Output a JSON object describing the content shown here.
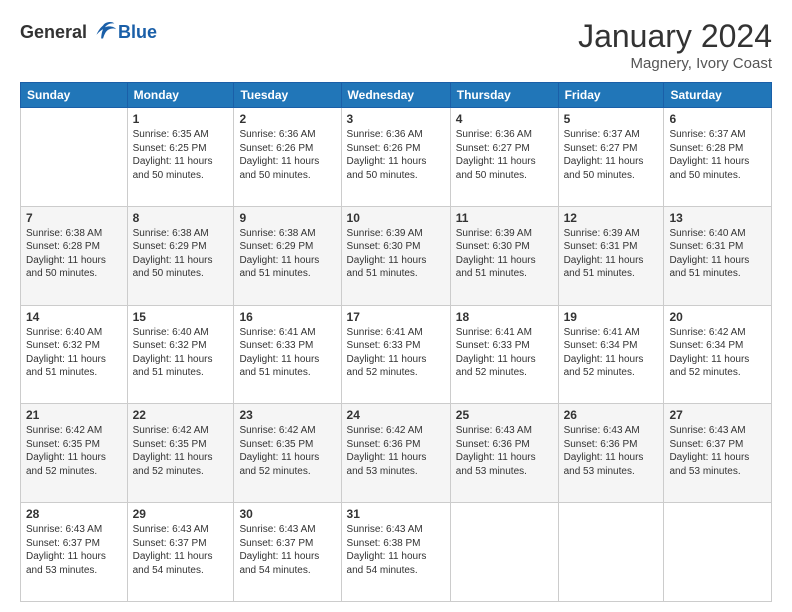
{
  "logo": {
    "general": "General",
    "blue": "Blue"
  },
  "title": "January 2024",
  "location": "Magnery, Ivory Coast",
  "headers": [
    "Sunday",
    "Monday",
    "Tuesday",
    "Wednesday",
    "Thursday",
    "Friday",
    "Saturday"
  ],
  "weeks": [
    [
      {
        "day": "",
        "info": ""
      },
      {
        "day": "1",
        "info": "Sunrise: 6:35 AM\nSunset: 6:25 PM\nDaylight: 11 hours\nand 50 minutes."
      },
      {
        "day": "2",
        "info": "Sunrise: 6:36 AM\nSunset: 6:26 PM\nDaylight: 11 hours\nand 50 minutes."
      },
      {
        "day": "3",
        "info": "Sunrise: 6:36 AM\nSunset: 6:26 PM\nDaylight: 11 hours\nand 50 minutes."
      },
      {
        "day": "4",
        "info": "Sunrise: 6:36 AM\nSunset: 6:27 PM\nDaylight: 11 hours\nand 50 minutes."
      },
      {
        "day": "5",
        "info": "Sunrise: 6:37 AM\nSunset: 6:27 PM\nDaylight: 11 hours\nand 50 minutes."
      },
      {
        "day": "6",
        "info": "Sunrise: 6:37 AM\nSunset: 6:28 PM\nDaylight: 11 hours\nand 50 minutes."
      }
    ],
    [
      {
        "day": "7",
        "info": "Sunrise: 6:38 AM\nSunset: 6:28 PM\nDaylight: 11 hours\nand 50 minutes."
      },
      {
        "day": "8",
        "info": "Sunrise: 6:38 AM\nSunset: 6:29 PM\nDaylight: 11 hours\nand 50 minutes."
      },
      {
        "day": "9",
        "info": "Sunrise: 6:38 AM\nSunset: 6:29 PM\nDaylight: 11 hours\nand 51 minutes."
      },
      {
        "day": "10",
        "info": "Sunrise: 6:39 AM\nSunset: 6:30 PM\nDaylight: 11 hours\nand 51 minutes."
      },
      {
        "day": "11",
        "info": "Sunrise: 6:39 AM\nSunset: 6:30 PM\nDaylight: 11 hours\nand 51 minutes."
      },
      {
        "day": "12",
        "info": "Sunrise: 6:39 AM\nSunset: 6:31 PM\nDaylight: 11 hours\nand 51 minutes."
      },
      {
        "day": "13",
        "info": "Sunrise: 6:40 AM\nSunset: 6:31 PM\nDaylight: 11 hours\nand 51 minutes."
      }
    ],
    [
      {
        "day": "14",
        "info": "Sunrise: 6:40 AM\nSunset: 6:32 PM\nDaylight: 11 hours\nand 51 minutes."
      },
      {
        "day": "15",
        "info": "Sunrise: 6:40 AM\nSunset: 6:32 PM\nDaylight: 11 hours\nand 51 minutes."
      },
      {
        "day": "16",
        "info": "Sunrise: 6:41 AM\nSunset: 6:33 PM\nDaylight: 11 hours\nand 51 minutes."
      },
      {
        "day": "17",
        "info": "Sunrise: 6:41 AM\nSunset: 6:33 PM\nDaylight: 11 hours\nand 52 minutes."
      },
      {
        "day": "18",
        "info": "Sunrise: 6:41 AM\nSunset: 6:33 PM\nDaylight: 11 hours\nand 52 minutes."
      },
      {
        "day": "19",
        "info": "Sunrise: 6:41 AM\nSunset: 6:34 PM\nDaylight: 11 hours\nand 52 minutes."
      },
      {
        "day": "20",
        "info": "Sunrise: 6:42 AM\nSunset: 6:34 PM\nDaylight: 11 hours\nand 52 minutes."
      }
    ],
    [
      {
        "day": "21",
        "info": "Sunrise: 6:42 AM\nSunset: 6:35 PM\nDaylight: 11 hours\nand 52 minutes."
      },
      {
        "day": "22",
        "info": "Sunrise: 6:42 AM\nSunset: 6:35 PM\nDaylight: 11 hours\nand 52 minutes."
      },
      {
        "day": "23",
        "info": "Sunrise: 6:42 AM\nSunset: 6:35 PM\nDaylight: 11 hours\nand 52 minutes."
      },
      {
        "day": "24",
        "info": "Sunrise: 6:42 AM\nSunset: 6:36 PM\nDaylight: 11 hours\nand 53 minutes."
      },
      {
        "day": "25",
        "info": "Sunrise: 6:43 AM\nSunset: 6:36 PM\nDaylight: 11 hours\nand 53 minutes."
      },
      {
        "day": "26",
        "info": "Sunrise: 6:43 AM\nSunset: 6:36 PM\nDaylight: 11 hours\nand 53 minutes."
      },
      {
        "day": "27",
        "info": "Sunrise: 6:43 AM\nSunset: 6:37 PM\nDaylight: 11 hours\nand 53 minutes."
      }
    ],
    [
      {
        "day": "28",
        "info": "Sunrise: 6:43 AM\nSunset: 6:37 PM\nDaylight: 11 hours\nand 53 minutes."
      },
      {
        "day": "29",
        "info": "Sunrise: 6:43 AM\nSunset: 6:37 PM\nDaylight: 11 hours\nand 54 minutes."
      },
      {
        "day": "30",
        "info": "Sunrise: 6:43 AM\nSunset: 6:37 PM\nDaylight: 11 hours\nand 54 minutes."
      },
      {
        "day": "31",
        "info": "Sunrise: 6:43 AM\nSunset: 6:38 PM\nDaylight: 11 hours\nand 54 minutes."
      },
      {
        "day": "",
        "info": ""
      },
      {
        "day": "",
        "info": ""
      },
      {
        "day": "",
        "info": ""
      }
    ]
  ]
}
